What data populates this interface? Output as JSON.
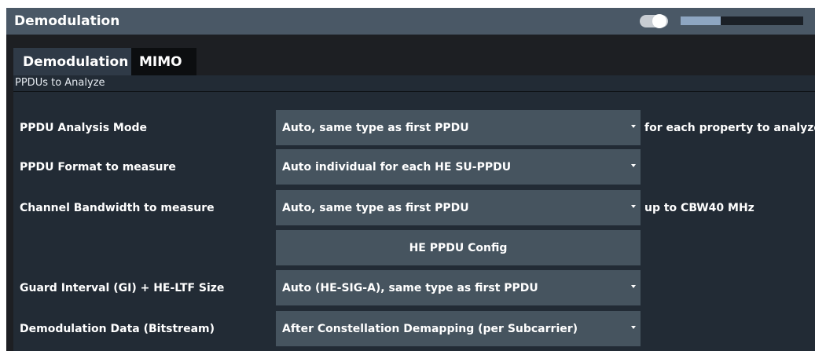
{
  "dialog": {
    "title": "Demodulation",
    "toggle_state": "on",
    "level_fraction": 0.33
  },
  "tabs": [
    {
      "label": "Demodulation",
      "active": true
    },
    {
      "label": "MIMO",
      "active": false
    }
  ],
  "section": {
    "title": "PPDUs to Analyze"
  },
  "rows": {
    "analysis_mode": {
      "label": "PPDU Analysis Mode",
      "value": "Auto, same type as first PPDU",
      "note": "for each property to analyze"
    },
    "format": {
      "label": "PPDU Format to measure",
      "value": "Auto individual for each HE SU-PPDU"
    },
    "bandwidth": {
      "label": "Channel Bandwidth to measure",
      "value": "Auto, same type as first PPDU",
      "note": "up to CBW40 MHz"
    },
    "config_button": "HE PPDU Config",
    "guard_interval": {
      "label": "Guard Interval (GI) + HE-LTF Size",
      "value": "Auto (HE-SIG-A), same type as first PPDU"
    },
    "demod_data": {
      "label": "Demodulation Data (Bitstream)",
      "value": "After Constellation Demapping (per Subcarrier)"
    }
  },
  "icons": {
    "dropdown": "chevron-down-icon"
  },
  "colors": {
    "titlebar": "#4a5866",
    "panel": "#222b35",
    "control": "#46545f",
    "active_tab": "#2f3a47",
    "inactive_tab": "#0c0e10"
  }
}
